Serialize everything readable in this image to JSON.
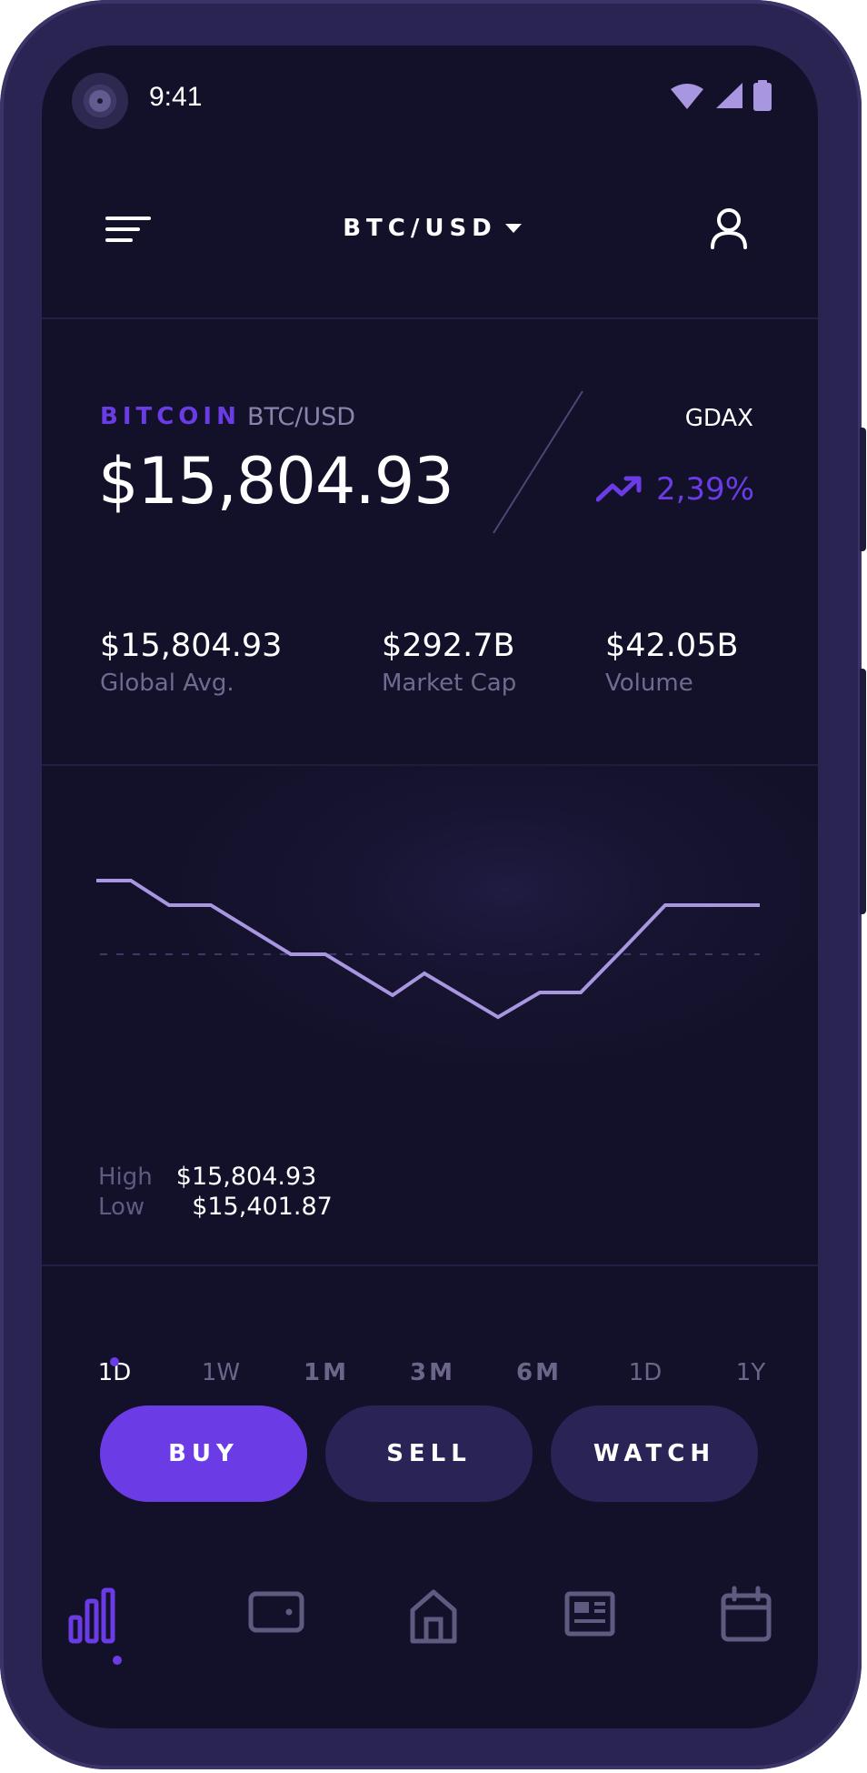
{
  "status_bar": {
    "time": "9:41"
  },
  "header": {
    "pair_selector": "BTC/USD"
  },
  "ticker": {
    "coin_name": "BITCOIN",
    "pair": "BTC/USD",
    "price": "$15,804.93",
    "exchange": "GDAX",
    "change": "2,39%"
  },
  "stats": [
    {
      "value": "$15,804.93",
      "label": "Global Avg."
    },
    {
      "value": "$292.7B",
      "label": "Market Cap"
    },
    {
      "value": "$42.05B",
      "label": "Volume"
    }
  ],
  "high_low": {
    "high_label": "High",
    "high_value": "$15,804.93",
    "low_label": "Low",
    "low_value": "$15,401.87"
  },
  "ranges": [
    {
      "label": "1D",
      "active": true
    },
    {
      "label": "1W",
      "active": false
    },
    {
      "label": "1M",
      "active": false
    },
    {
      "label": "3M",
      "active": false
    },
    {
      "label": "6M",
      "active": false
    },
    {
      "label": "1D",
      "active": false
    },
    {
      "label": "1Y",
      "active": false
    }
  ],
  "actions": {
    "buy": "BUY",
    "sell": "SELL",
    "watch": "WATCH"
  },
  "bottom_nav": [
    {
      "icon": "bar-chart-icon",
      "active": true
    },
    {
      "icon": "wallet-icon",
      "active": false
    },
    {
      "icon": "home-icon",
      "active": false
    },
    {
      "icon": "news-icon",
      "active": false
    },
    {
      "icon": "calendar-icon",
      "active": false
    }
  ],
  "colors": {
    "accent": "#6b3ce6",
    "background": "#13112a",
    "frame": "#2a2452",
    "secondary_button": "#2a2456",
    "line": "#a896e0"
  },
  "chart_data": {
    "type": "line",
    "title": "",
    "xlabel": "",
    "ylabel": "",
    "grid": false,
    "ylim": [
      15401.87,
      15804.93
    ],
    "reference_line": "dashed",
    "x": [
      0,
      1,
      2,
      3,
      4,
      5,
      6,
      7,
      8,
      9,
      10,
      11,
      12,
      13,
      14
    ],
    "series": [
      {
        "values": [
          15804.93,
          15804.93,
          15760,
          15760,
          15670,
          15670,
          15595,
          15635,
          15555,
          15600,
          15600,
          15680,
          15760,
          15760,
          15760
        ]
      }
    ]
  }
}
